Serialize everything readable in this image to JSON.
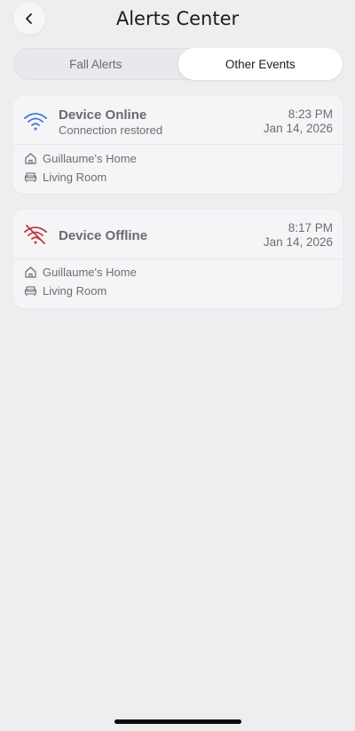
{
  "header": {
    "title": "Alerts Center"
  },
  "tabs": [
    {
      "label": "Fall Alerts",
      "active": false
    },
    {
      "label": "Other Events",
      "active": true
    }
  ],
  "events": [
    {
      "title": "Device Online",
      "subtitle": "Connection restored",
      "time": "8:23 PM",
      "date": "Jan 14, 2026",
      "home": "Guillaume's Home",
      "room": "Living Room",
      "icon": "wifi-icon",
      "icon_color": "#3a78d6"
    },
    {
      "title": "Device Offline",
      "time": "8:17 PM",
      "date": "Jan 14, 2026",
      "home": "Guillaume's Home",
      "room": "Living Room",
      "icon": "wifi-off-icon",
      "icon_color": "#c0393b"
    }
  ]
}
